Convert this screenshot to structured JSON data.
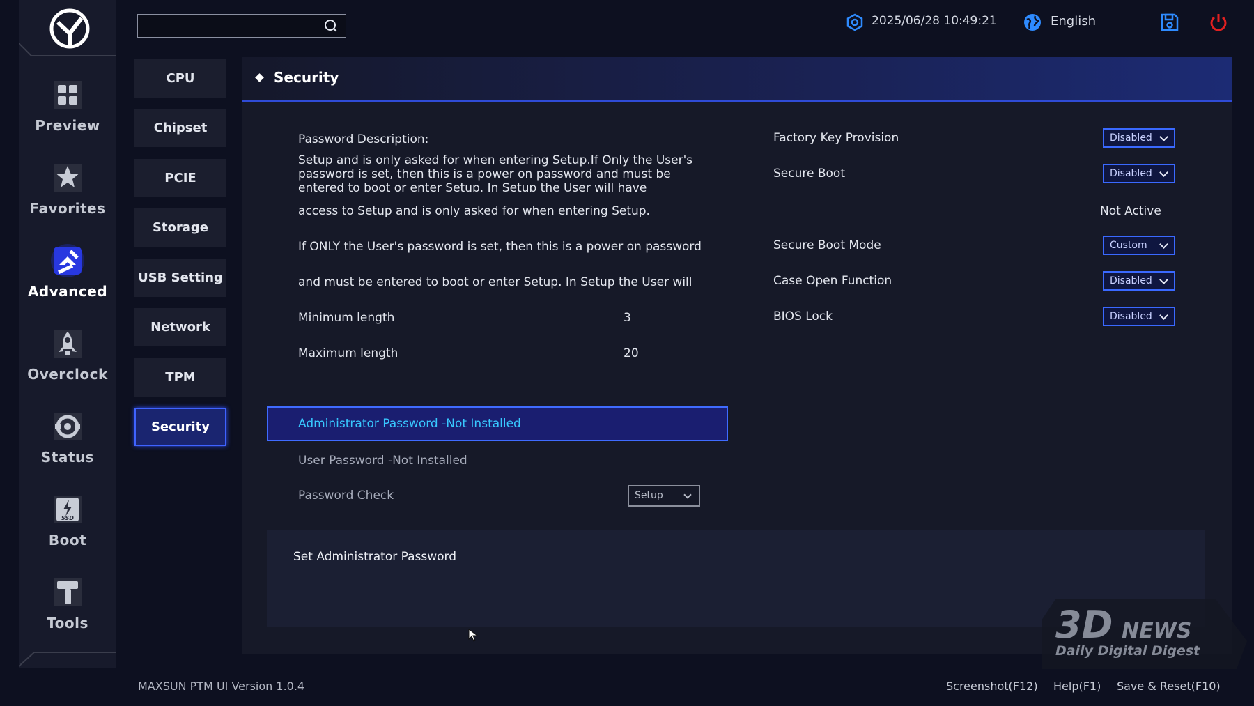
{
  "topbar": {
    "search_placeholder": "",
    "datetime": "2025/06/28 10:49:21",
    "language": "English"
  },
  "rail": {
    "items": [
      {
        "label": "Preview",
        "icon": "preview-grid-icon"
      },
      {
        "label": "Favorites",
        "icon": "star-icon"
      },
      {
        "label": "Advanced",
        "icon": "advanced-icon",
        "active": true
      },
      {
        "label": "Overclock",
        "icon": "rocket-icon"
      },
      {
        "label": "Status",
        "icon": "status-gauge-icon"
      },
      {
        "label": "Boot",
        "icon": "ssd-icon"
      },
      {
        "label": "Tools",
        "icon": "hammer-icon"
      }
    ]
  },
  "submenu": {
    "items": [
      "CPU",
      "Chipset",
      "PCIE",
      "Storage",
      "USB Setting",
      "Network",
      "TPM",
      "Security"
    ],
    "active": "Security"
  },
  "section": {
    "title": "Security"
  },
  "left": {
    "desc_title": "Password Description:",
    "desc_text": "Setup and is only asked for when entering Setup.If Only the User's password is set, then this is a power on password and must be entered to boot or enter Setup. In Setup the User will have Administrator rights.The",
    "line1": "access to Setup and is only asked for when entering Setup.",
    "line2": "If ONLY the User's password is set, then this is a power on password",
    "line3": "and must be entered to boot or enter Setup. In Setup the User will",
    "min_label": "Minimum length",
    "min_value": "3",
    "max_label": "Maximum length",
    "max_value": "20",
    "admin_password": "Administrator Password -Not Installed",
    "user_password": "User Password -Not Installed",
    "password_check_label": "Password Check",
    "password_check_value": "Setup"
  },
  "right": {
    "factory_key_label": "Factory Key Provision",
    "factory_key_value": "Disabled",
    "secure_boot_label": "Secure Boot",
    "secure_boot_value": "Disabled",
    "secure_boot_status": "Not Active",
    "secure_boot_mode_label": "Secure Boot Mode",
    "secure_boot_mode_value": "Custom",
    "case_open_label": "Case Open Function",
    "case_open_value": "Disabled",
    "bios_lock_label": "BIOS Lock",
    "bios_lock_value": "Disabled"
  },
  "help": {
    "title": "Set Administrator Password"
  },
  "footer": {
    "version": "MAXSUN PTM UI Version 1.0.4",
    "screenshot": "Screenshot(F12)",
    "help": "Help(F1)",
    "save_reset": "Save & Reset(F10)"
  },
  "watermark": {
    "brand": "3DNEWS",
    "tagline": "Daily Digital Digest"
  },
  "colors": {
    "accent": "#3f6bff",
    "highlight_text": "#38c8ff",
    "power": "#e02020",
    "icon_blue": "#2e8bff"
  }
}
